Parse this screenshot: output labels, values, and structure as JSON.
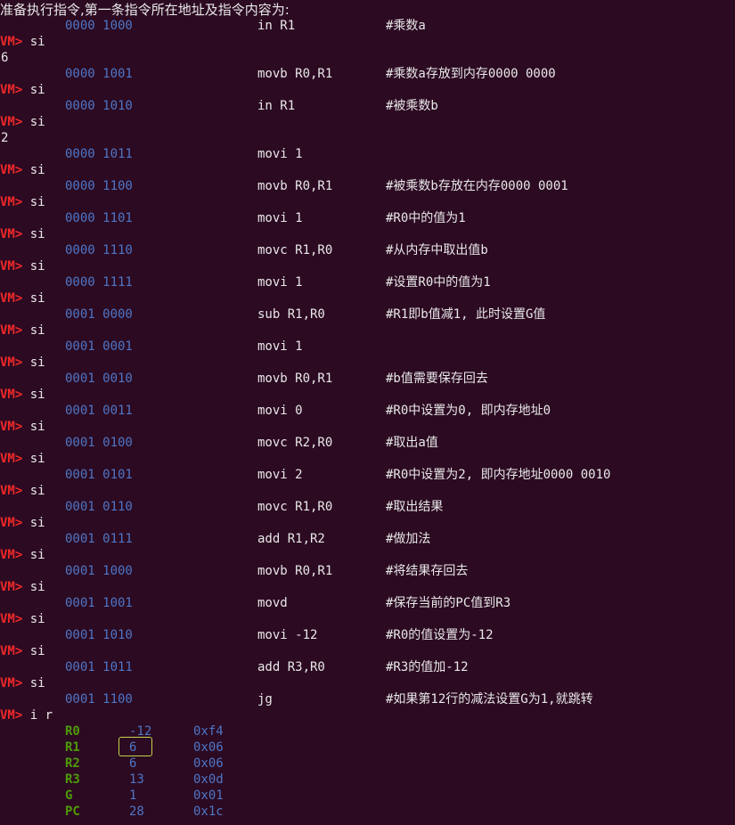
{
  "header": "准备执行指令,第一条指令所在地址及指令内容为:",
  "prompt": "VM>",
  "lines": [
    {
      "t": "instr",
      "addr": "0000 1000",
      "op": "in R1",
      "cmt": "#乘数a"
    },
    {
      "t": "prompt",
      "cmd": " si"
    },
    {
      "t": "output",
      "text": "6"
    },
    {
      "t": "instr",
      "addr": "0000 1001",
      "op": "movb R0,R1",
      "cmt": "#乘数a存放到内存0000 0000"
    },
    {
      "t": "prompt",
      "cmd": " si"
    },
    {
      "t": "instr",
      "addr": "0000 1010",
      "op": "in R1",
      "cmt": "#被乘数b"
    },
    {
      "t": "prompt",
      "cmd": " si"
    },
    {
      "t": "output",
      "text": "2"
    },
    {
      "t": "instr",
      "addr": "0000 1011",
      "op": "movi 1",
      "cmt": ""
    },
    {
      "t": "prompt",
      "cmd": " si"
    },
    {
      "t": "instr",
      "addr": "0000 1100",
      "op": "movb R0,R1",
      "cmt": "#被乘数b存放在内存0000 0001"
    },
    {
      "t": "prompt",
      "cmd": " si"
    },
    {
      "t": "instr",
      "addr": "0000 1101",
      "op": "movi 1",
      "cmt": "#R0中的值为1"
    },
    {
      "t": "prompt",
      "cmd": " si"
    },
    {
      "t": "instr",
      "addr": "0000 1110",
      "op": "movc R1,R0",
      "cmt": "#从内存中取出值b"
    },
    {
      "t": "prompt",
      "cmd": " si"
    },
    {
      "t": "instr",
      "addr": "0000 1111",
      "op": "movi 1",
      "cmt": "#设置R0中的值为1"
    },
    {
      "t": "prompt",
      "cmd": " si"
    },
    {
      "t": "instr",
      "addr": "0001 0000",
      "op": "sub R1,R0",
      "cmt": "#R1即b值减1, 此时设置G值"
    },
    {
      "t": "prompt",
      "cmd": " si"
    },
    {
      "t": "instr",
      "addr": "0001 0001",
      "op": "movi 1",
      "cmt": ""
    },
    {
      "t": "prompt",
      "cmd": " si"
    },
    {
      "t": "instr",
      "addr": "0001 0010",
      "op": "movb R0,R1",
      "cmt": "#b值需要保存回去"
    },
    {
      "t": "prompt",
      "cmd": " si"
    },
    {
      "t": "instr",
      "addr": "0001 0011",
      "op": "movi 0",
      "cmt": "#R0中设置为0, 即内存地址0"
    },
    {
      "t": "prompt",
      "cmd": " si"
    },
    {
      "t": "instr",
      "addr": "0001 0100",
      "op": "movc R2,R0",
      "cmt": "#取出a值"
    },
    {
      "t": "prompt",
      "cmd": " si"
    },
    {
      "t": "instr",
      "addr": "0001 0101",
      "op": "movi 2",
      "cmt": "#R0中设置为2, 即内存地址0000 0010"
    },
    {
      "t": "prompt",
      "cmd": " si"
    },
    {
      "t": "instr",
      "addr": "0001 0110",
      "op": "movc R1,R0",
      "cmt": "#取出结果"
    },
    {
      "t": "prompt",
      "cmd": " si"
    },
    {
      "t": "instr",
      "addr": "0001 0111",
      "op": "add R1,R2",
      "cmt": "#做加法"
    },
    {
      "t": "prompt",
      "cmd": " si"
    },
    {
      "t": "instr",
      "addr": "0001 1000",
      "op": "movb R0,R1",
      "cmt": "#将结果存回去"
    },
    {
      "t": "prompt",
      "cmd": " si"
    },
    {
      "t": "instr",
      "addr": "0001 1001",
      "op": "movd",
      "cmt": "#保存当前的PC值到R3"
    },
    {
      "t": "prompt",
      "cmd": " si"
    },
    {
      "t": "instr",
      "addr": "0001 1010",
      "op": "movi -12",
      "cmt": "#R0的值设置为-12"
    },
    {
      "t": "prompt",
      "cmd": " si"
    },
    {
      "t": "instr",
      "addr": "0001 1011",
      "op": "add R3,R0",
      "cmt": "#R3的值加-12"
    },
    {
      "t": "prompt",
      "cmd": " si"
    },
    {
      "t": "instr",
      "addr": "0001 1100",
      "op": "jg",
      "cmt": "#如果第12行的减法设置G为1,就跳转"
    },
    {
      "t": "prompt",
      "cmd": " i r"
    },
    {
      "t": "reg",
      "name": "R0",
      "dec": "-12",
      "hex": "0xf4"
    },
    {
      "t": "reg",
      "name": "R1",
      "dec": "6",
      "hex": "0x06",
      "highlight": true
    },
    {
      "t": "reg",
      "name": "R2",
      "dec": "6",
      "hex": "0x06"
    },
    {
      "t": "reg",
      "name": "R3",
      "dec": "13",
      "hex": "0x0d"
    },
    {
      "t": "reg",
      "name": "G",
      "dec": "1",
      "hex": "0x01"
    },
    {
      "t": "reg",
      "name": "PC",
      "dec": "28",
      "hex": "0x1c"
    }
  ],
  "colors": {
    "background": "#2c0a22",
    "prompt": "#ef2929",
    "address": "#4e76c6",
    "register_name": "#4e9a06",
    "highlight_box": "#c3d34a",
    "text": "#e8e8e8"
  }
}
